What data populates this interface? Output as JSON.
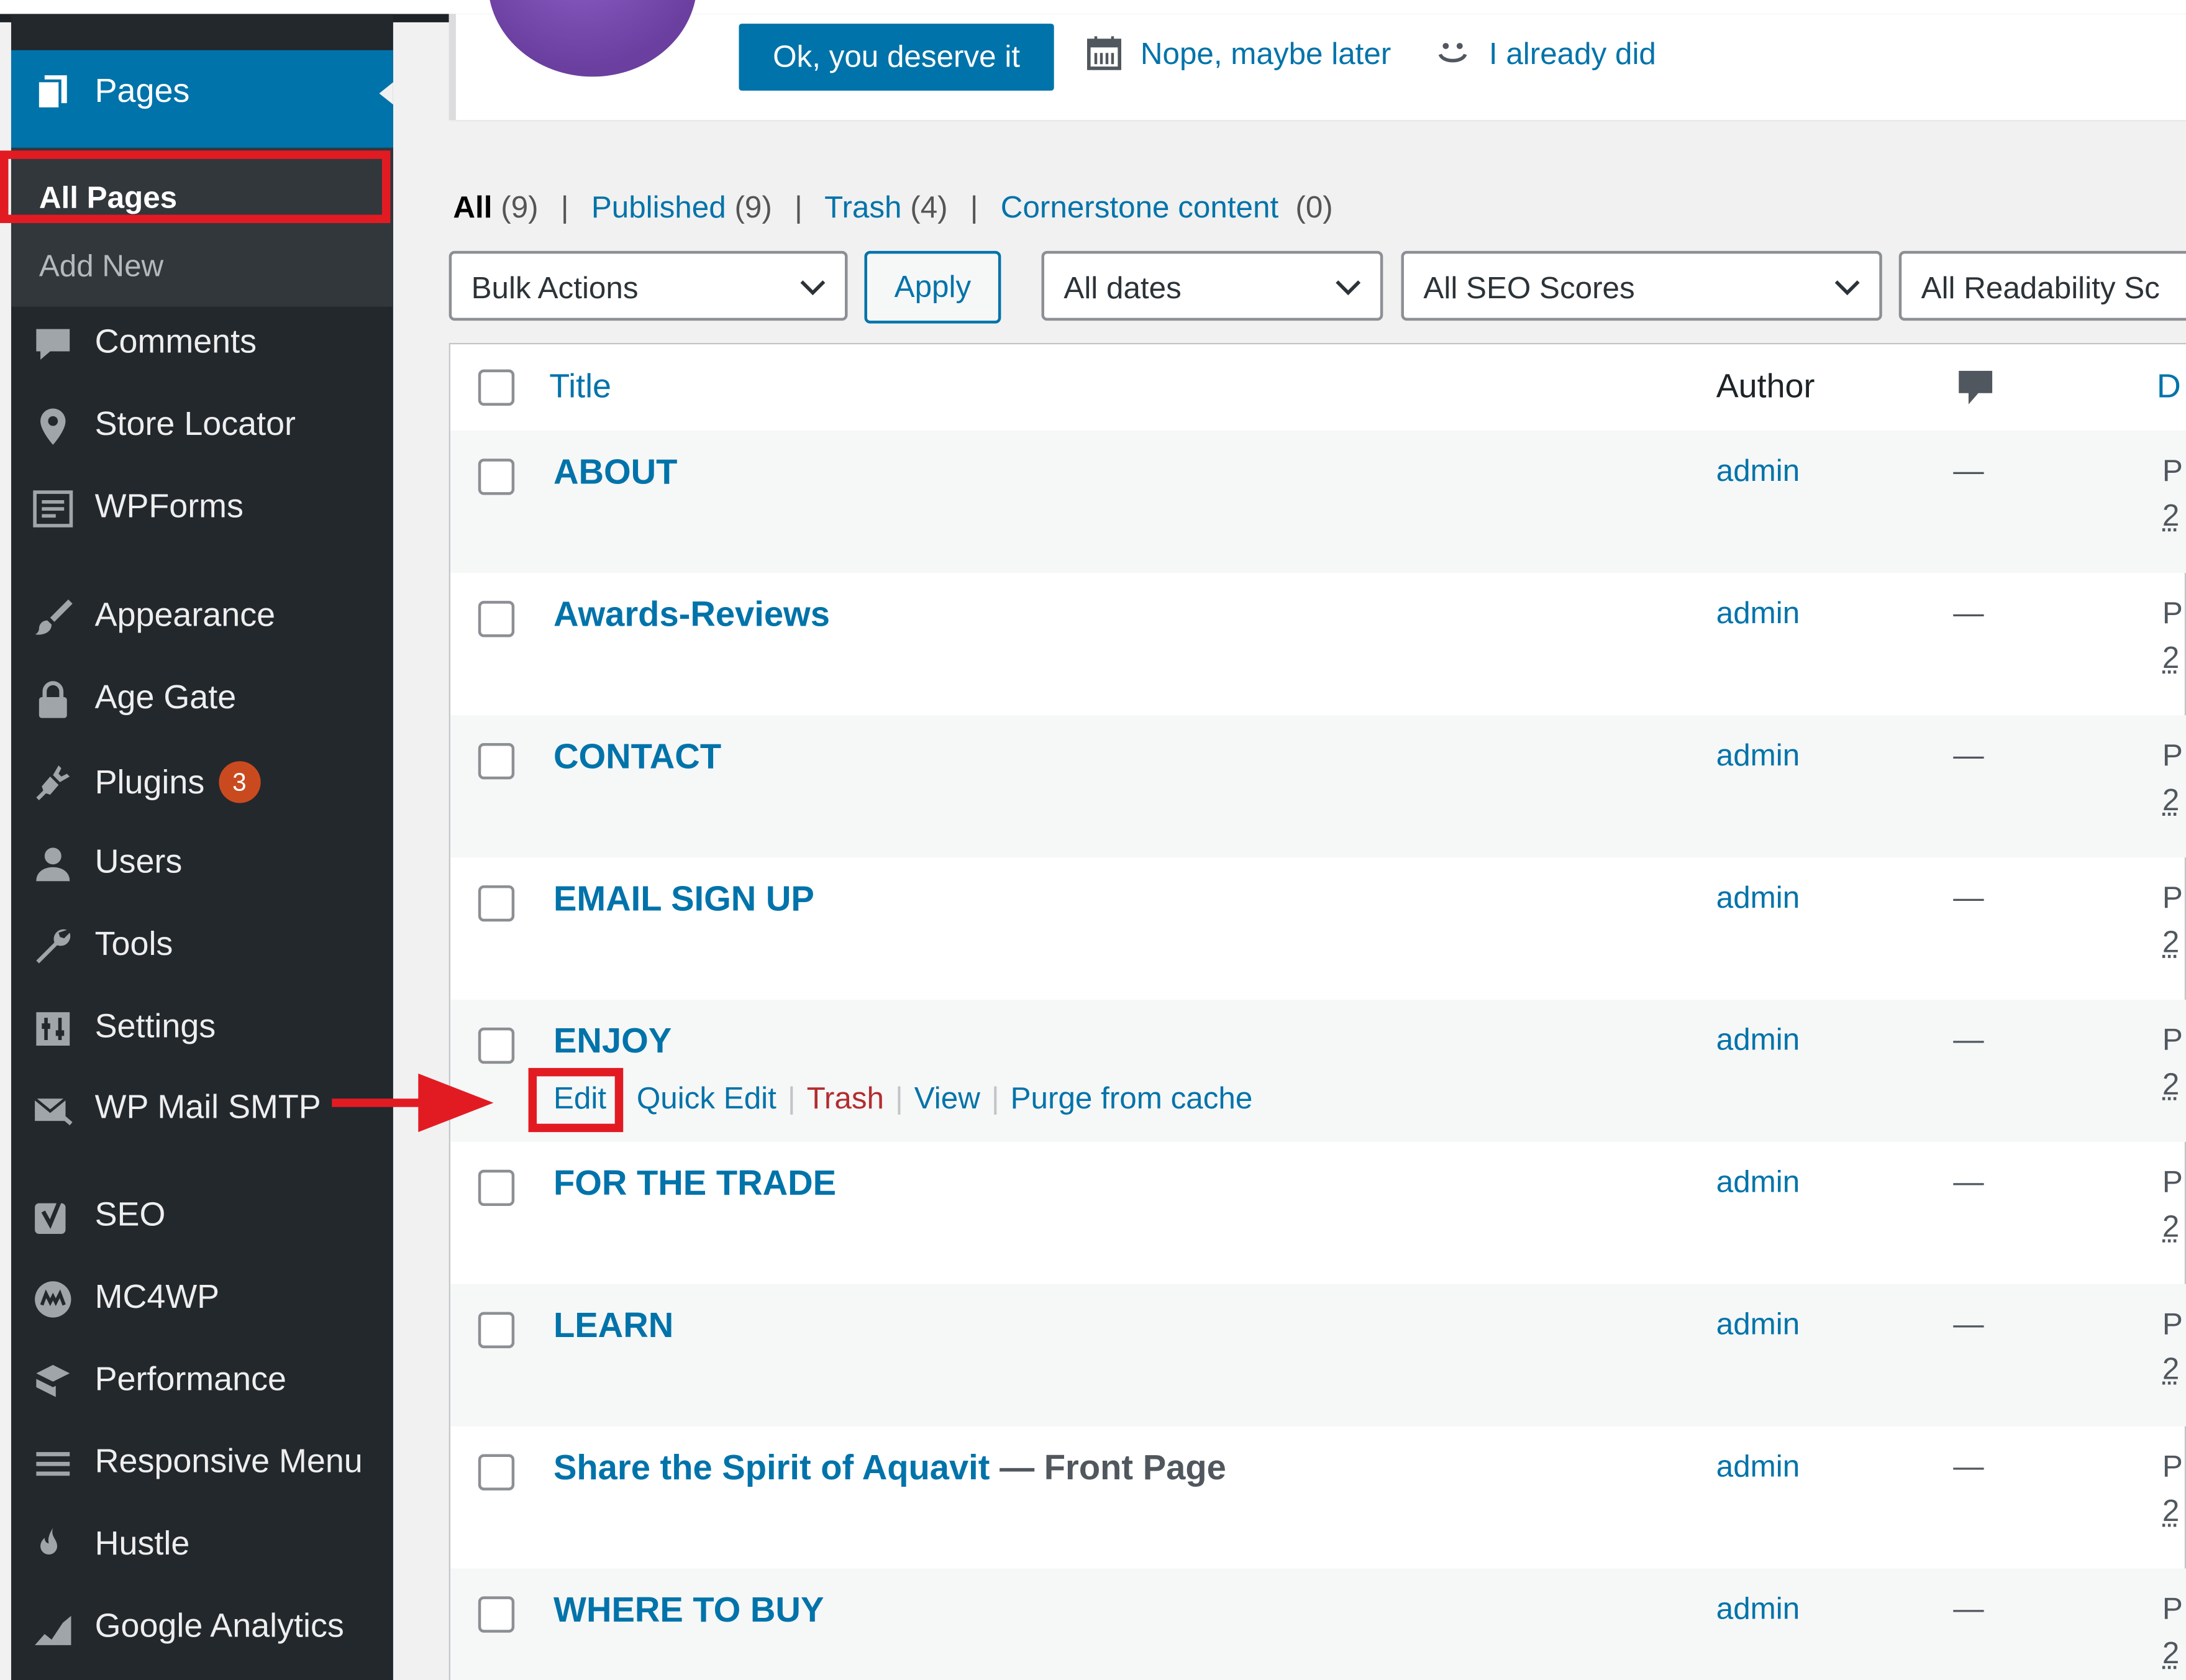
{
  "sidebar": {
    "active": {
      "label": "Pages",
      "icon": "pages-icon"
    },
    "submenu": [
      {
        "label": "All Pages",
        "active": true
      },
      {
        "label": "Add New",
        "active": false
      }
    ],
    "items": [
      {
        "label": "Comments",
        "icon": "comments-icon"
      },
      {
        "label": "Store Locator",
        "icon": "map-pin-icon"
      },
      {
        "label": "WPForms",
        "icon": "wpforms-icon"
      },
      {
        "label": "Appearance",
        "icon": "paintbrush-icon"
      },
      {
        "label": "Age Gate",
        "icon": "lock-icon"
      },
      {
        "label": "Plugins",
        "icon": "plugins-icon",
        "badge": "3"
      },
      {
        "label": "Users",
        "icon": "users-icon"
      },
      {
        "label": "Tools",
        "icon": "wrench-icon"
      },
      {
        "label": "Settings",
        "icon": "settings-icon"
      },
      {
        "label": "WP Mail SMTP",
        "icon": "mail-icon"
      },
      {
        "label": "SEO",
        "icon": "yoast-icon"
      },
      {
        "label": "MC4WP",
        "icon": "mc4wp-icon"
      },
      {
        "label": "Performance",
        "icon": "performance-icon"
      },
      {
        "label": "Responsive Menu",
        "icon": "hamburger-icon"
      },
      {
        "label": "Hustle",
        "icon": "hustle-icon"
      },
      {
        "label": "Google Analytics",
        "icon": "analytics-icon"
      }
    ]
  },
  "notice": {
    "ok_label": "Ok, you deserve it",
    "later_label": "Nope, maybe later",
    "did_label": "I already did"
  },
  "filters": {
    "all": {
      "label": "All",
      "count": "(9)"
    },
    "published": {
      "label": "Published",
      "count": "(9)"
    },
    "trash": {
      "label": "Trash",
      "count": "(4)"
    },
    "cornerstone": {
      "label": "Cornerstone content",
      "count": "(0)"
    },
    "separator": "|",
    "bulk_actions": "Bulk Actions",
    "apply": "Apply",
    "dates": "All dates",
    "seo_scores": "All SEO Scores",
    "readability": "All Readability Sc"
  },
  "table": {
    "columns": {
      "title": "Title",
      "author": "Author",
      "date": "D"
    },
    "rows": [
      {
        "title": "ABOUT",
        "author": "admin",
        "comments": "—",
        "date1": "P",
        "date2": "2"
      },
      {
        "title": "Awards-Reviews",
        "author": "admin",
        "comments": "—",
        "date1": "P",
        "date2": "2"
      },
      {
        "title": "CONTACT",
        "author": "admin",
        "comments": "—",
        "date1": "P",
        "date2": "2"
      },
      {
        "title": "EMAIL SIGN UP",
        "author": "admin",
        "comments": "—",
        "date1": "P",
        "date2": "2"
      },
      {
        "title": "ENJOY",
        "author": "admin",
        "comments": "—",
        "date1": "P",
        "date2": "2"
      },
      {
        "title": "FOR THE TRADE",
        "author": "admin",
        "comments": "—",
        "date1": "P",
        "date2": "2"
      },
      {
        "title": "LEARN",
        "author": "admin",
        "comments": "—",
        "date1": "P",
        "date2": "2"
      },
      {
        "title": "Share the Spirit of Aquavit",
        "state": " — Front Page",
        "author": "admin",
        "comments": "—",
        "date1": "P",
        "date2": "2"
      },
      {
        "title": "WHERE TO BUY",
        "author": "admin",
        "comments": "—",
        "date1": "P",
        "date2": "2"
      }
    ],
    "row_actions": {
      "edit": "Edit",
      "quick_edit": "Quick Edit",
      "trash": "Trash",
      "view": "View",
      "purge": "Purge from cache",
      "separator": "|"
    }
  },
  "colors": {
    "sidebar_bg": "#23282d",
    "accent": "#0073aa",
    "annotation": "#e21b23",
    "badge": "#ca4a1f"
  }
}
